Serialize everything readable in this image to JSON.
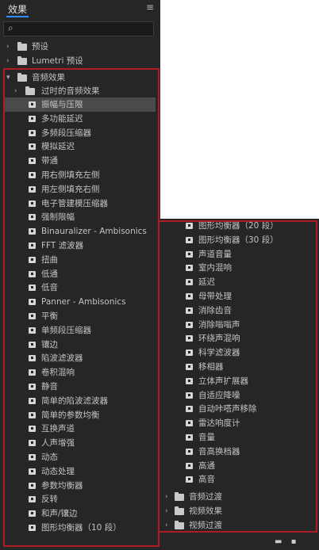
{
  "panel": {
    "title": "效果",
    "menu_icon": "≡",
    "search_icon": "⌕"
  },
  "top_level": [
    {
      "label": "预设",
      "expanded": false
    },
    {
      "label": "Lumetri 预设",
      "expanded": false
    },
    {
      "label": "音频效果",
      "expanded": true
    }
  ],
  "audio_effects_subfolder": "过时的音频效果",
  "audio_effects_left": [
    "振幅与压限",
    "多功能延迟",
    "多频段压缩器",
    "模拟延迟",
    "带通",
    "用右侧填充左侧",
    "用左侧填充右侧",
    "电子管建模压缩器",
    "强制限幅",
    "Binauralizer - Ambisonics",
    "FFT 滤波器",
    "扭曲",
    "低通",
    "低音",
    "Panner - Ambisonics",
    "平衡",
    "单频段压缩器",
    "镶边",
    "陷波滤波器",
    "卷积混响",
    "静音",
    "简单的陷波滤波器",
    "简单的参数均衡",
    "互换声道",
    "人声增强",
    "动态",
    "动态处理",
    "参数均衡器",
    "反转",
    "和声/镶边",
    "图形均衡器（10 段）"
  ],
  "audio_effects_right": [
    "图形均衡器（20 段）",
    "图形均衡器（30 段）",
    "声道音量",
    "室内混响",
    "延迟",
    "母带处理",
    "消除齿音",
    "消除嗡嗡声",
    "环绕声混响",
    "科学滤波器",
    "移相器",
    "立体声扩展器",
    "自适应降噪",
    "自动咔嗒声移除",
    "雷达响度计",
    "音量",
    "音高换档器",
    "高通",
    "高音"
  ],
  "bottom_folders": [
    {
      "label": "音频过渡"
    },
    {
      "label": "视频效果"
    },
    {
      "label": "视频过渡"
    }
  ],
  "colors": {
    "accent": "#2b8dff",
    "highlight_border": "#b01c26",
    "panel_bg": "#262626"
  }
}
